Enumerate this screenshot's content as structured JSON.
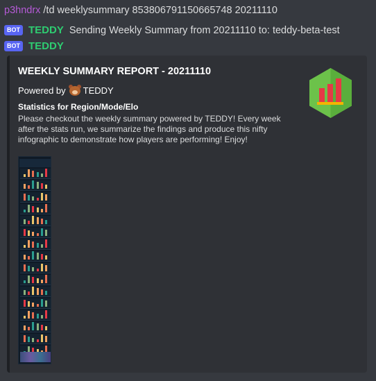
{
  "command": {
    "user": "p3hndrx",
    "text": "/td weeklysummary 853806791150665748 20211110"
  },
  "bot_messages": [
    {
      "badge": "BOT",
      "name": "TEDDY",
      "text": "Sending Weekly Summary from 20211110 to: teddy-beta-test"
    },
    {
      "badge": "BOT",
      "name": "TEDDY",
      "text": ""
    }
  ],
  "embed": {
    "title": "WEEKLY SUMMARY REPORT - 20211110",
    "author_prefix": "Powered by",
    "author_name": "TEDDY",
    "field_name": "Statistics for Region/Mode/Elo",
    "field_value": "Please checkout the weekly summary powered by TEDDY! Every week after the stats run, we summarize the findings and produce this nifty infographic to demonstrate how players are performing! Enjoy!",
    "thumbnail_icon": "bar-chart-hexagon-icon",
    "infographic_icon": "infographic-image"
  },
  "colors": {
    "username": "#b55ad6",
    "bot_name": "#2ecc71",
    "badge": "#5865f2",
    "embed_bg": "#2f3136",
    "hex_green": "#6cc24a",
    "chart_red": "#e63946",
    "chart_base": "#f4b400"
  }
}
